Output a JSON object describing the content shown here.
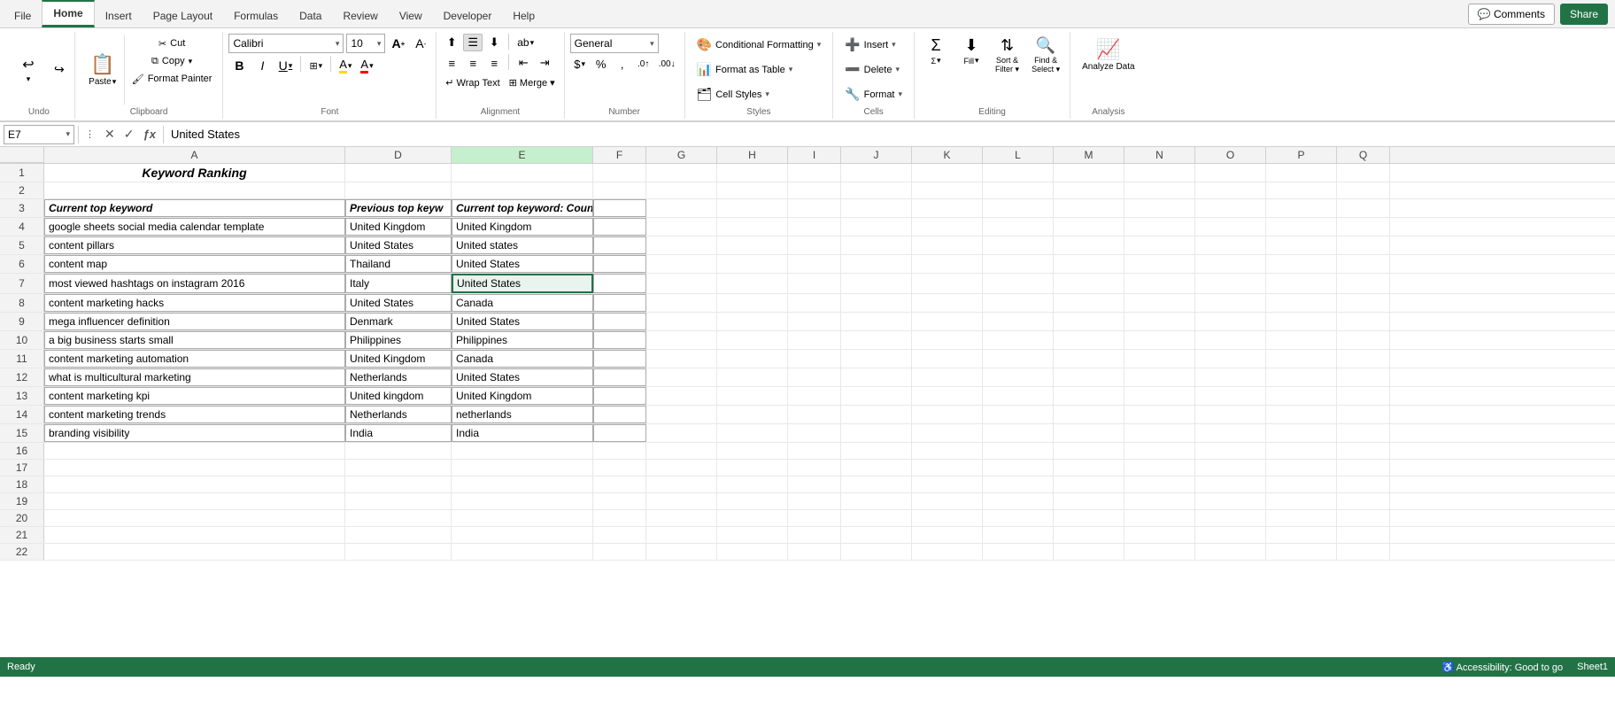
{
  "tabs": {
    "items": [
      "File",
      "Home",
      "Insert",
      "Page Layout",
      "Formulas",
      "Data",
      "Review",
      "View",
      "Developer",
      "Help"
    ],
    "active": "Home"
  },
  "topright": {
    "comments": "💬 Comments",
    "share": "Share"
  },
  "ribbon": {
    "groups": {
      "undo": {
        "label": "Undo",
        "redo_label": "Redo"
      },
      "clipboard": {
        "label": "Clipboard",
        "paste": "Paste",
        "cut": "Cut",
        "copy": "Copy",
        "format_painter": "Format Painter"
      },
      "font": {
        "label": "Font",
        "font_name": "Calibri",
        "font_size": "10",
        "grow": "A",
        "shrink": "A",
        "bold": "B",
        "italic": "I",
        "underline": "U",
        "borders": "⊞",
        "fill_color": "A",
        "font_color": "A"
      },
      "alignment": {
        "label": "Alignment",
        "top_align": "⊤",
        "middle_align": "≡",
        "bottom_align": "⊥",
        "left_align": "≡",
        "center_align": "≡",
        "right_align": "≡",
        "decrease_indent": "←",
        "increase_indent": "→",
        "wrap_text": "↵",
        "merge": "⊞"
      },
      "number": {
        "label": "Number",
        "format": "General",
        "percent": "%",
        "comma": ",",
        "currency": "$",
        "increase_decimal": ".0",
        "decrease_decimal": ".00"
      },
      "styles": {
        "label": "Styles",
        "conditional_formatting": "Conditional Formatting",
        "format_as_table": "Format as Table",
        "cell_styles": "Cell Styles"
      },
      "cells": {
        "label": "Cells",
        "insert": "Insert",
        "delete": "Delete",
        "format": "Format"
      },
      "editing": {
        "label": "Editing",
        "sum": "Σ",
        "fill": "↓",
        "sort_filter": "Sort & Filter",
        "find_select": "Find & Select"
      },
      "analysis": {
        "label": "Analysis",
        "analyze_data": "Analyze Data"
      }
    }
  },
  "formula_bar": {
    "cell_ref": "E7",
    "value": "United States"
  },
  "columns": [
    "A",
    "D",
    "E",
    "F",
    "G",
    "H",
    "I",
    "J",
    "K",
    "L",
    "M",
    "N",
    "O",
    "P",
    "Q"
  ],
  "col_headers_display": {
    "1": "A",
    "2": "D",
    "3": "E",
    "4": "F",
    "5": "G",
    "6": "H",
    "7": "I",
    "8": "J",
    "9": "K",
    "10": "L",
    "11": "M",
    "12": "N",
    "13": "O",
    "14": "P",
    "15": "Q"
  },
  "spreadsheet": {
    "title_row": 1,
    "title": "Keyword Ranking",
    "header_row": 3,
    "headers": {
      "A": "Current top keyword",
      "D": "Previous top keyw",
      "E": "Current top keyword: Country"
    },
    "rows": [
      {
        "row": 4,
        "A": "google sheets social media calendar template",
        "D": "United Kingdom",
        "E": "United Kingdom"
      },
      {
        "row": 5,
        "A": "content pillars",
        "D": "United States",
        "E": "United states"
      },
      {
        "row": 6,
        "A": "content map",
        "D": "Thailand",
        "E": "United States"
      },
      {
        "row": 7,
        "A": "most viewed hashtags on instagram 2016",
        "D": "Italy",
        "E": "United States"
      },
      {
        "row": 8,
        "A": "content marketing hacks",
        "D": "United States",
        "E": "Canada"
      },
      {
        "row": 9,
        "A": "mega influencer definition",
        "D": "Denmark",
        "E": "United States"
      },
      {
        "row": 10,
        "A": "a big business starts small",
        "D": "Philippines",
        "E": "Philippines"
      },
      {
        "row": 11,
        "A": "content marketing automation",
        "D": "United Kingdom",
        "E": "Canada"
      },
      {
        "row": 12,
        "A": "what is multicultural marketing",
        "D": "Netherlands",
        "E": "United States"
      },
      {
        "row": 13,
        "A": "content marketing kpi",
        "D": "United kingdom",
        "E": "United Kingdom"
      },
      {
        "row": 14,
        "A": "content marketing trends",
        "D": "Netherlands",
        "E": "netherlands"
      },
      {
        "row": 15,
        "A": "branding visibility",
        "D": "India",
        "E": "India"
      }
    ]
  },
  "status_bar": {
    "mode": "Ready"
  }
}
